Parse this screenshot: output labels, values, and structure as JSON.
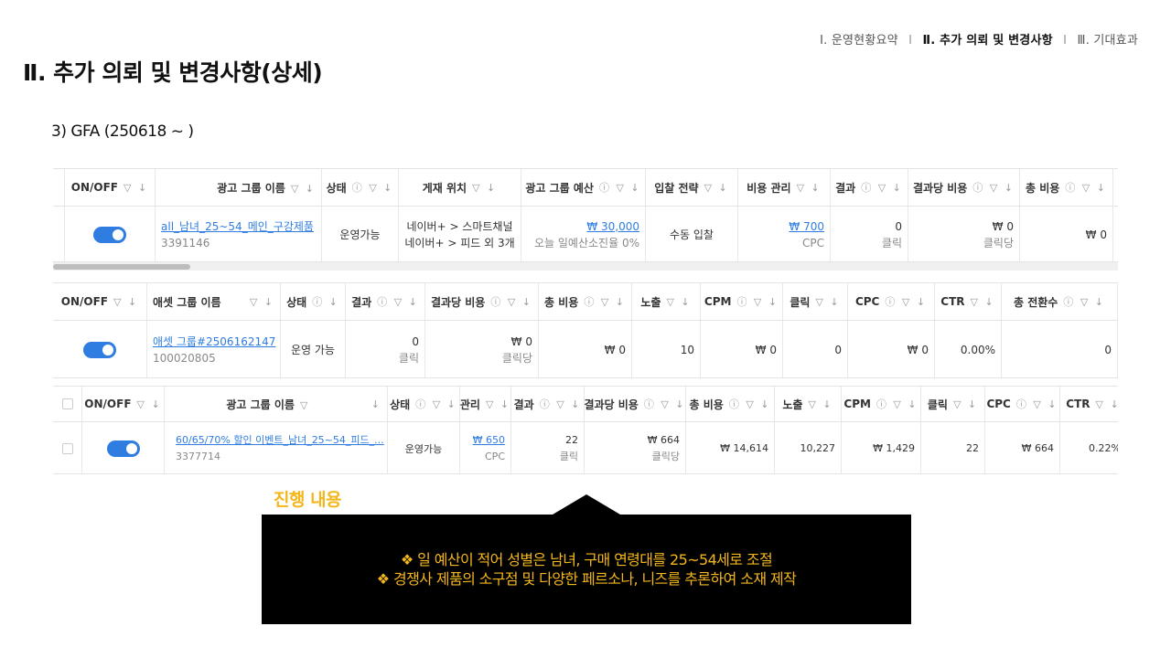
{
  "topnav": {
    "item1": "Ⅰ. 운영현황요약",
    "item2": "Ⅱ. 추가 의뢰 및 변경사항",
    "item3": "Ⅲ. 기대효과",
    "sep": "I"
  },
  "page_title": "Ⅱ. 추가 의뢰 및 변경사항(상세)",
  "section_sub": "3) GFA (250618 ~ )",
  "table1": {
    "headers": [
      "ON/OFF",
      "광고 그룹 이름",
      "상태",
      "게재 위치",
      "광고 그룹 예산",
      "입찰 전략",
      "비용 관리",
      "결과",
      "결과당 비용",
      "총 비용"
    ],
    "header_icons": [
      "▽ ↓",
      "▽ ↓",
      "ⓘ ▽ ↓",
      "▽ ↓",
      "ⓘ ▽ ↓",
      "▽ ↓",
      "▽ ↓",
      "ⓘ ▽ ↓",
      "ⓘ ▽ ↓",
      "ⓘ ▽ ↓"
    ],
    "row": {
      "name": "all_남녀_25~54_메인_구강제품",
      "id": "3391146",
      "status": "운영가능",
      "placement1": "네이버+ > 스마트채널",
      "placement2": "네이버+ > 피드 외 3개",
      "budget": "₩ 30,000",
      "budget_sub": "오늘 일예산소진율 0%",
      "bid": "수동 입찰",
      "cost_ctrl": "₩ 700",
      "cost_ctrl_sub": "CPC",
      "result": "0",
      "result_sub": "클릭",
      "cpr": "₩ 0",
      "cpr_sub": "클릭당",
      "total": "₩ 0"
    }
  },
  "table2": {
    "headers": [
      "ON/OFF",
      "애셋 그룹 이름",
      "상태",
      "결과",
      "결과당 비용",
      "총 비용",
      "노출",
      "CPM",
      "클릭",
      "CPC",
      "CTR",
      "총 전환수"
    ],
    "header_icons": [
      "▽ ↓",
      "▽ ↓",
      "ⓘ ↓",
      "ⓘ ▽ ↓",
      "ⓘ ▽ ↓",
      "ⓘ ▽ ↓",
      "▽ ↓",
      "ⓘ ▽ ↓",
      "▽ ↓",
      "ⓘ ▽ ↓",
      "▽ ↓",
      "ⓘ ▽ ↓"
    ],
    "row": {
      "name": "애셋 그룹#2506162147",
      "id": "100020805",
      "status": "운영 가능",
      "result": "0",
      "result_sub": "클릭",
      "cpr": "₩ 0",
      "cpr_sub": "클릭당",
      "total": "₩ 0",
      "impressions": "10",
      "cpm": "₩ 0",
      "clicks": "0",
      "cpc": "₩ 0",
      "ctr": "0.00%",
      "conversions": "0"
    }
  },
  "table3": {
    "headers": [
      "ON/OFF",
      "광고 그룹 이름",
      "상태",
      "관리",
      "결과",
      "결과당 비용",
      "총 비용",
      "노출",
      "CPM",
      "클릭",
      "CPC",
      "CTR"
    ],
    "header_icons": [
      "▽ ↓",
      "▽",
      "ⓘ ▽ ↓",
      "▽ ↓",
      "ⓘ ▽ ↓",
      "ⓘ ▽ ↓",
      "ⓘ ▽ ↓",
      "▽ ↓",
      "ⓘ ▽ ↓",
      "▽ ↓",
      "ⓘ ▽ ↓",
      "▽ ↓"
    ],
    "name_sort_icon": "↓",
    "row": {
      "name": "60/65/70% 할인 이벤트_남녀_25~54_피드_...",
      "id": "3377714",
      "status": "운영가능",
      "cost_ctrl": "₩ 650",
      "cost_ctrl_sub": "CPC",
      "result": "22",
      "result_sub": "클릭",
      "cpr": "₩ 664",
      "cpr_sub": "클릭당",
      "total": "₩ 14,614",
      "impressions": "10,227",
      "cpm": "₩ 1,429",
      "clicks": "22",
      "cpc": "₩ 664",
      "ctr": "0.22%"
    }
  },
  "progress_label": "진행 내용",
  "callout": {
    "line1": "❖ 일 예산이 적어 성별은 남녀, 구매 연령대를 25~54세로 조절",
    "line2": "❖ 경쟁사 제품의 소구점 및 다양한 페르소나, 니즈를 추론하여 소재 제작"
  },
  "colors": {
    "toggle": "#2f7de1",
    "accent": "#f3b71c",
    "callout_bg": "#000000",
    "link": "#2f7de1"
  }
}
